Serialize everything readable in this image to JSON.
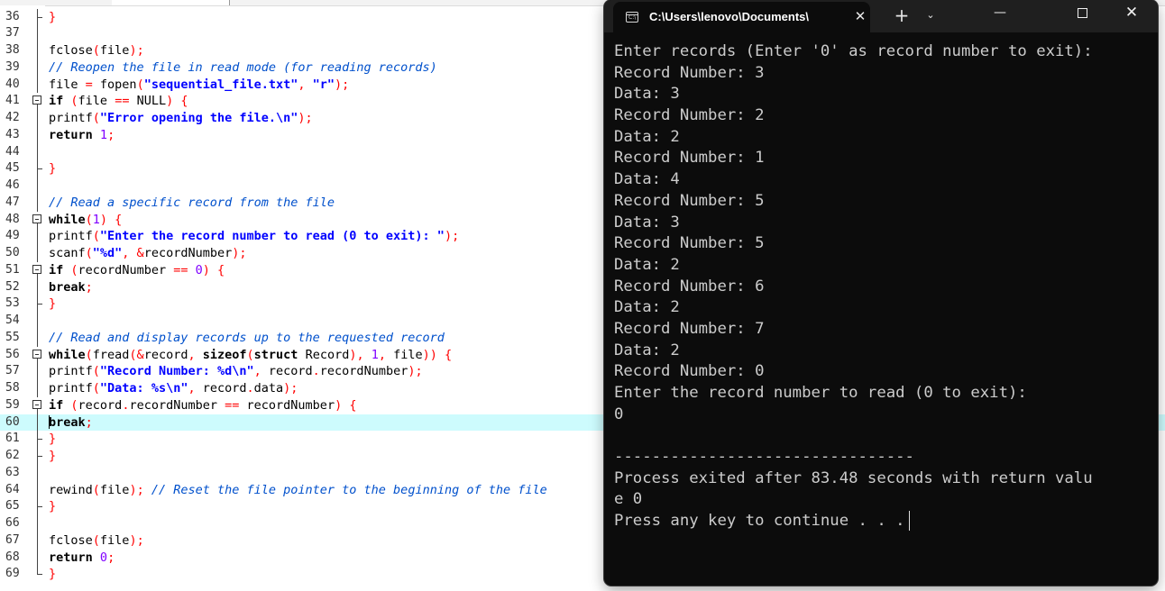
{
  "editor": {
    "lines": [
      {
        "n": "36",
        "fold": "end",
        "tokens": [
          [
            "op",
            "}"
          ]
        ]
      },
      {
        "n": "37",
        "fold": "line",
        "tokens": []
      },
      {
        "n": "38",
        "fold": "line",
        "tokens": [
          [
            "pl",
            "fclose"
          ],
          [
            "op",
            "("
          ],
          [
            "pl",
            "file"
          ],
          [
            "op",
            ");"
          ]
        ]
      },
      {
        "n": "39",
        "fold": "line",
        "tokens": [
          [
            "com",
            "// Reopen the file in read mode (for reading records)"
          ]
        ]
      },
      {
        "n": "40",
        "fold": "line",
        "tokens": [
          [
            "pl",
            "file "
          ],
          [
            "op",
            "="
          ],
          [
            "pl",
            " fopen"
          ],
          [
            "op",
            "("
          ],
          [
            "str",
            "\"sequential_file.txt\""
          ],
          [
            "op",
            ", "
          ],
          [
            "str",
            "\"r\""
          ],
          [
            "op",
            ");"
          ]
        ]
      },
      {
        "n": "41",
        "fold": "box",
        "tokens": [
          [
            "kw",
            "if"
          ],
          [
            "pl",
            " "
          ],
          [
            "op",
            "("
          ],
          [
            "pl",
            "file "
          ],
          [
            "op",
            "=="
          ],
          [
            "pl",
            " NULL"
          ],
          [
            "op",
            ") {"
          ]
        ]
      },
      {
        "n": "42",
        "fold": "line",
        "tokens": [
          [
            "pl",
            "printf"
          ],
          [
            "op",
            "("
          ],
          [
            "str",
            "\"Error opening the file.\\n\""
          ],
          [
            "op",
            ");"
          ]
        ]
      },
      {
        "n": "43",
        "fold": "line",
        "tokens": [
          [
            "kw",
            "return"
          ],
          [
            "pl",
            " "
          ],
          [
            "num",
            "1"
          ],
          [
            "op",
            ";"
          ]
        ]
      },
      {
        "n": "44",
        "fold": "line",
        "tokens": []
      },
      {
        "n": "45",
        "fold": "end",
        "tokens": [
          [
            "op",
            "}"
          ]
        ]
      },
      {
        "n": "46",
        "fold": "line",
        "tokens": []
      },
      {
        "n": "47",
        "fold": "line",
        "tokens": [
          [
            "com",
            "// Read a specific record from the file"
          ]
        ]
      },
      {
        "n": "48",
        "fold": "box",
        "tokens": [
          [
            "kw",
            "while"
          ],
          [
            "op",
            "("
          ],
          [
            "num",
            "1"
          ],
          [
            "op",
            ") {"
          ]
        ]
      },
      {
        "n": "49",
        "fold": "line",
        "tokens": [
          [
            "pl",
            "printf"
          ],
          [
            "op",
            "("
          ],
          [
            "str",
            "\"Enter the record number to read (0 to exit): \""
          ],
          [
            "op",
            ");"
          ]
        ]
      },
      {
        "n": "50",
        "fold": "line",
        "tokens": [
          [
            "pl",
            "scanf"
          ],
          [
            "op",
            "("
          ],
          [
            "str",
            "\"%d\""
          ],
          [
            "op",
            ", &"
          ],
          [
            "pl",
            "recordNumber"
          ],
          [
            "op",
            ");"
          ]
        ]
      },
      {
        "n": "51",
        "fold": "box",
        "tokens": [
          [
            "kw",
            "if"
          ],
          [
            "pl",
            " "
          ],
          [
            "op",
            "("
          ],
          [
            "pl",
            "recordNumber "
          ],
          [
            "op",
            "=="
          ],
          [
            "pl",
            " "
          ],
          [
            "num",
            "0"
          ],
          [
            "op",
            ") {"
          ]
        ]
      },
      {
        "n": "52",
        "fold": "line",
        "tokens": [
          [
            "kw",
            "break"
          ],
          [
            "op",
            ";"
          ]
        ]
      },
      {
        "n": "53",
        "fold": "end",
        "tokens": [
          [
            "op",
            "}"
          ]
        ]
      },
      {
        "n": "54",
        "fold": "line",
        "tokens": []
      },
      {
        "n": "55",
        "fold": "line",
        "tokens": [
          [
            "com",
            "// Read and display records up to the requested record"
          ]
        ]
      },
      {
        "n": "56",
        "fold": "box",
        "tokens": [
          [
            "kw",
            "while"
          ],
          [
            "op",
            "("
          ],
          [
            "pl",
            "fread"
          ],
          [
            "op",
            "(&"
          ],
          [
            "pl",
            "record"
          ],
          [
            "op",
            ", "
          ],
          [
            "kw",
            "sizeof"
          ],
          [
            "op",
            "("
          ],
          [
            "kw",
            "struct"
          ],
          [
            "pl",
            " Record"
          ],
          [
            "op",
            "), "
          ],
          [
            "num",
            "1"
          ],
          [
            "op",
            ", "
          ],
          [
            "pl",
            "file"
          ],
          [
            "op",
            ")) {"
          ]
        ]
      },
      {
        "n": "57",
        "fold": "line",
        "tokens": [
          [
            "pl",
            "printf"
          ],
          [
            "op",
            "("
          ],
          [
            "str",
            "\"Record Number: %d\\n\""
          ],
          [
            "op",
            ", "
          ],
          [
            "pl",
            "record"
          ],
          [
            "op",
            "."
          ],
          [
            "pl",
            "recordNumber"
          ],
          [
            "op",
            ");"
          ]
        ]
      },
      {
        "n": "58",
        "fold": "line",
        "tokens": [
          [
            "pl",
            "printf"
          ],
          [
            "op",
            "("
          ],
          [
            "str",
            "\"Data: %s\\n\""
          ],
          [
            "op",
            ", "
          ],
          [
            "pl",
            "record"
          ],
          [
            "op",
            "."
          ],
          [
            "pl",
            "data"
          ],
          [
            "op",
            ");"
          ]
        ]
      },
      {
        "n": "59",
        "fold": "box",
        "tokens": [
          [
            "kw",
            "if"
          ],
          [
            "pl",
            " "
          ],
          [
            "op",
            "("
          ],
          [
            "pl",
            "record"
          ],
          [
            "op",
            "."
          ],
          [
            "pl",
            "recordNumber "
          ],
          [
            "op",
            "=="
          ],
          [
            "pl",
            " recordNumber"
          ],
          [
            "op",
            ") {"
          ]
        ]
      },
      {
        "n": "60",
        "fold": "line",
        "hl": true,
        "caret": true,
        "tokens": [
          [
            "kw",
            "break"
          ],
          [
            "op",
            ";"
          ]
        ]
      },
      {
        "n": "61",
        "fold": "end",
        "tokens": [
          [
            "op",
            "}"
          ]
        ]
      },
      {
        "n": "62",
        "fold": "end",
        "tokens": [
          [
            "op",
            "}"
          ]
        ]
      },
      {
        "n": "63",
        "fold": "line",
        "tokens": []
      },
      {
        "n": "64",
        "fold": "line",
        "tokens": [
          [
            "pl",
            "rewind"
          ],
          [
            "op",
            "("
          ],
          [
            "pl",
            "file"
          ],
          [
            "op",
            ");"
          ],
          [
            "pl",
            " "
          ],
          [
            "com",
            "// Reset the file pointer to the beginning of the file"
          ]
        ]
      },
      {
        "n": "65",
        "fold": "end",
        "tokens": [
          [
            "op",
            "}"
          ]
        ]
      },
      {
        "n": "66",
        "fold": "line",
        "tokens": []
      },
      {
        "n": "67",
        "fold": "line",
        "tokens": [
          [
            "pl",
            "fclose"
          ],
          [
            "op",
            "("
          ],
          [
            "pl",
            "file"
          ],
          [
            "op",
            ");"
          ]
        ]
      },
      {
        "n": "68",
        "fold": "line",
        "tokens": [
          [
            "kw",
            "return"
          ],
          [
            "pl",
            " "
          ],
          [
            "num",
            "0"
          ],
          [
            "op",
            ";"
          ]
        ]
      },
      {
        "n": "69",
        "fold": "last",
        "tokens": [
          [
            "op",
            "}"
          ]
        ]
      }
    ]
  },
  "terminal": {
    "icon": "terminal-icon",
    "icon_glyph": "C:\\",
    "tab_title": "C:\\Users\\lenovo\\Documents\\",
    "close_tab": "✕",
    "new_tab": "+",
    "dropdown": "⌄",
    "minimize": "—",
    "close_window": "✕",
    "lines": [
      "Enter records (Enter '0' as record number to exit):",
      "Record Number: 3",
      "Data: 3",
      "Record Number: 2",
      "Data: 2",
      "Record Number: 1",
      "Data: 4",
      "Record Number: 5",
      "Data: 3",
      "Record Number: 5",
      "Data: 2",
      "Record Number: 6",
      "Data: 2",
      "Record Number: 7",
      "Data: 2",
      "Record Number: 0",
      "Enter the record number to read (0 to exit):",
      "0",
      "",
      "--------------------------------",
      "Process exited after 83.48 seconds with return valu",
      "e 0",
      "Press any key to continue . . ."
    ]
  }
}
